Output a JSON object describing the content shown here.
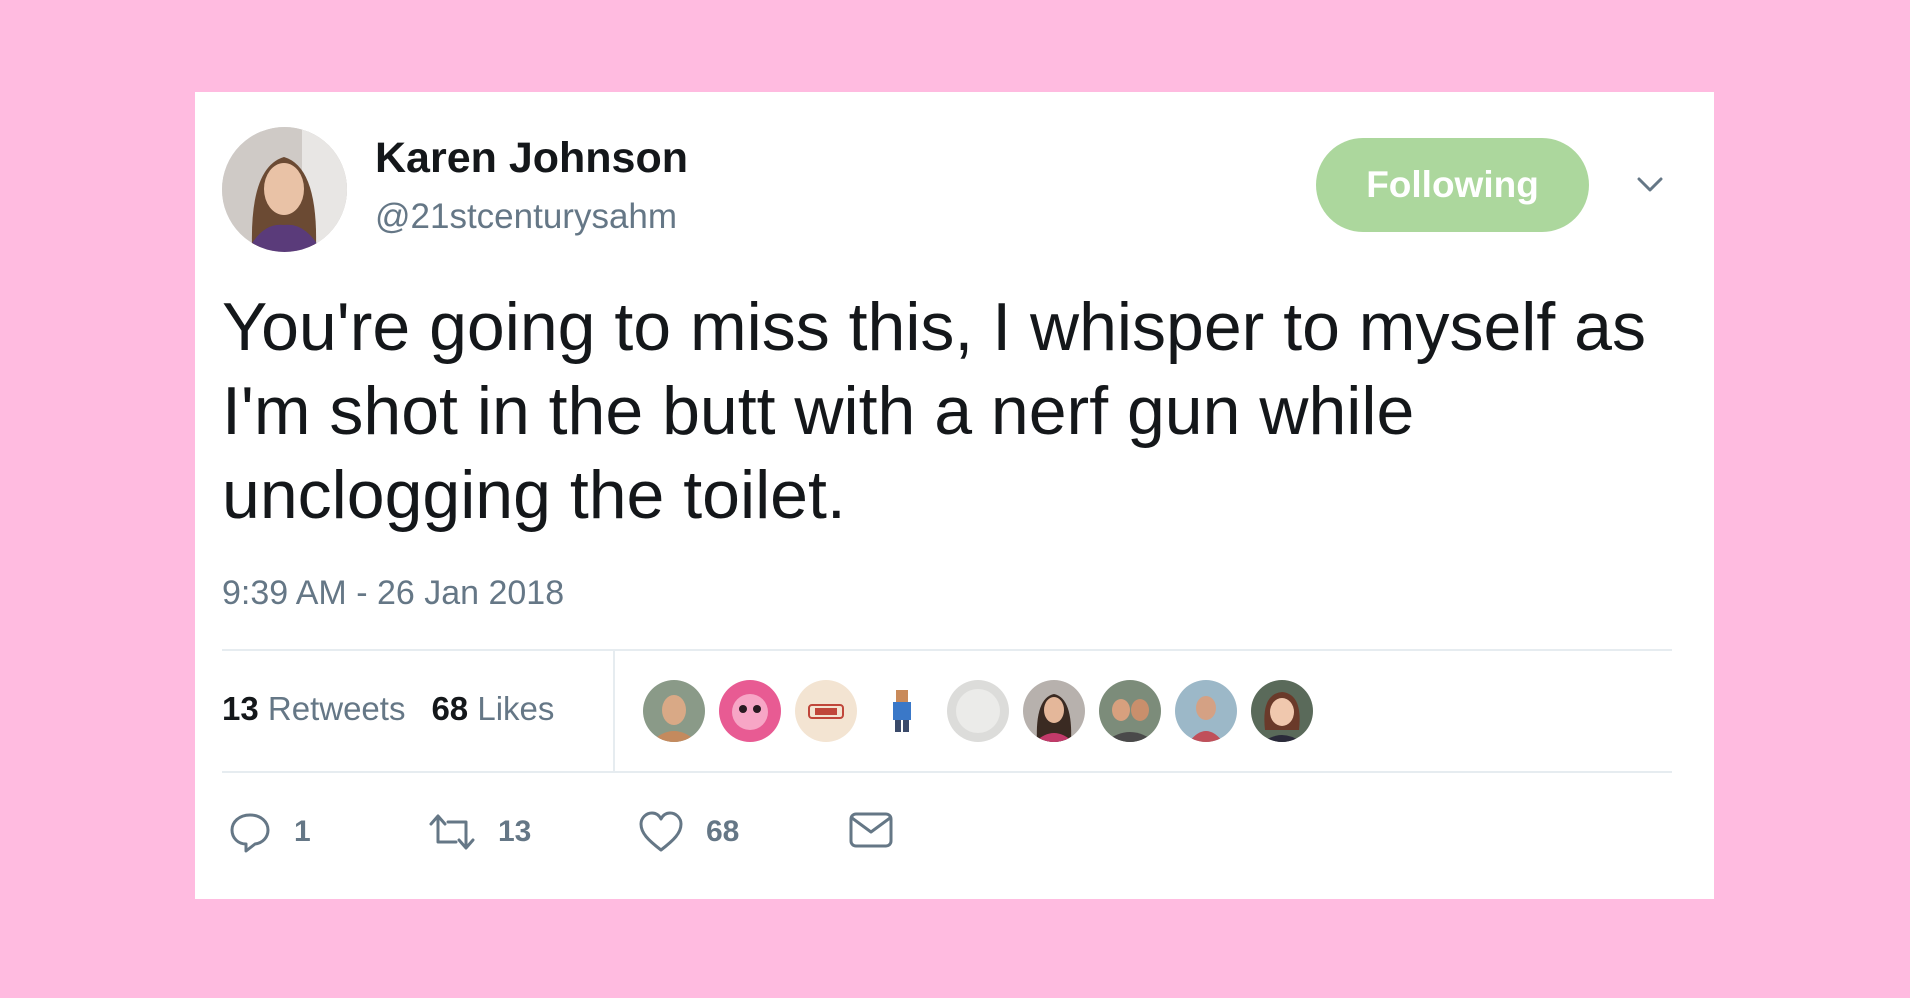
{
  "colors": {
    "background": "#ffbbe0",
    "follow_button": "#acd79d",
    "secondary_text": "#657786",
    "primary_text": "#14171a"
  },
  "user": {
    "display_name": "Karen Johnson",
    "handle": "@21stcenturysahm"
  },
  "follow_button": {
    "label": "Following"
  },
  "tweet": {
    "text": "You're going to miss this, I whisper to myself as I'm shot in the butt with a nerf gun while unclogging the toilet.",
    "timestamp": "9:39 AM - 26 Jan 2018"
  },
  "stats": {
    "retweets_count": "13",
    "retweets_label": "Retweets",
    "likes_count": "68",
    "likes_label": "Likes"
  },
  "actions": {
    "reply_count": "1",
    "retweet_count": "13",
    "like_count": "68"
  },
  "icons": [
    "reply-icon",
    "retweet-icon",
    "heart-icon",
    "direct-message-icon",
    "chevron-down-icon"
  ]
}
